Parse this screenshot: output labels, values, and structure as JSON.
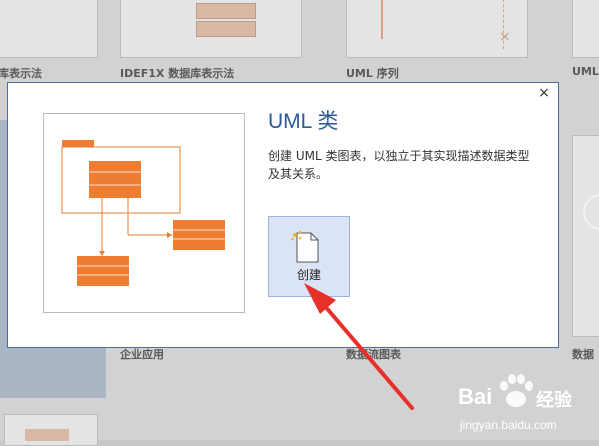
{
  "gallery": {
    "tiles": [
      {
        "label": "库表示法"
      },
      {
        "label": "IDEF1X 数据库表示法"
      },
      {
        "label": "UML 序列"
      },
      {
        "label": "UML"
      },
      {
        "label": "企业应用"
      },
      {
        "label": "数据流图表"
      },
      {
        "label": "数据"
      }
    ]
  },
  "dialog": {
    "close_label": "×",
    "title": "UML 类",
    "description": "创建 UML 类图表，以独立于其实现描述数据类型及其关系。",
    "create_label": "创建"
  },
  "watermark": {
    "brand": "Bai",
    "brand2": "经验",
    "url": "jingyan.baidu.com"
  },
  "colors": {
    "accent": "#2e5b96",
    "uml_box": "#ed7d31",
    "arrow": "#e8302b",
    "create_bg": "#dbe3f6"
  }
}
